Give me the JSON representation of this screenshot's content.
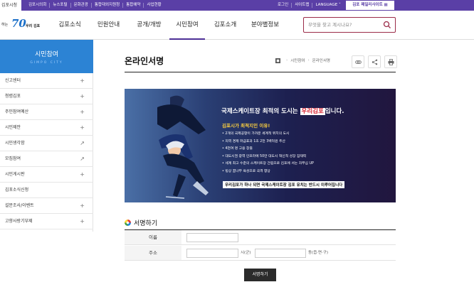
{
  "topbar": {
    "site_name": "김포시청",
    "links": [
      "김포시의회",
      "뉴스포털",
      "문화관광",
      "통합대외지원청",
      "통합예약",
      "사업현황"
    ],
    "login": "로그인",
    "sitemap": "사이트맵",
    "language": "LANGUAGE ˅",
    "family_site": "김포 패밀리사이트 ▦",
    "colors": {
      "bar": "#5a3fa6"
    }
  },
  "header": {
    "logo": {
      "prefix": "하는",
      "number": "70",
      "name": "우리 김포"
    },
    "nav": [
      "김포소식",
      "민원안내",
      "공개/개방",
      "시민참여",
      "김포소개",
      "분야별정보"
    ],
    "active_nav": "시민참여",
    "search_placeholder": "무엇을 찾고 계시나요?"
  },
  "sidebar": {
    "title": "시민참여",
    "subtitle": "GIMPO CITY",
    "items": [
      {
        "label": "신고센터",
        "marker": "+"
      },
      {
        "label": "청렴김포",
        "marker": "+"
      },
      {
        "label": "주민참여예산",
        "marker": "+"
      },
      {
        "label": "시민제안",
        "marker": "+"
      },
      {
        "label": "시민생각함",
        "marker": "↗"
      },
      {
        "label": "모집참여",
        "marker": "↗"
      },
      {
        "label": "시민게시판",
        "marker": "+"
      },
      {
        "label": "김포소식신청",
        "marker": ""
      },
      {
        "label": "설문조사/이벤트",
        "marker": "+"
      },
      {
        "label": "고향사랑기부제",
        "marker": "+"
      }
    ]
  },
  "content": {
    "title": "온라인서명",
    "breadcrumb": [
      "시민참여",
      "온라인서명"
    ],
    "tools": [
      "link-icon",
      "share-icon",
      "print-icon"
    ]
  },
  "banner": {
    "headline_before": "국제스케이트장 최적의 도시는 ",
    "headline_highlight": "우리김포",
    "headline_after": "입니다.",
    "subheading": "김포시가 최적지인 이유!",
    "reasons": [
      "• 2개의 국제공항이 가까운 세계적 위치의 도시",
      "• 지역 경제 파급효과 1조 2천 3백억원 추산",
      "• 4천여 명 고용 창출",
      "• 대도시권 광역 인프라에 50만 대도시 혁신적 성장 잠재력",
      "• 세계 최고 수준의 스케이트장 건립으로 김포에 서는 자부심 UP",
      "• 빙상 꿈나무 육성으로 국격 향상"
    ],
    "footer": "우리김포가 하나 되면 국제스케이트장 김포 유치는 반드시 이루어집니다"
  },
  "form": {
    "title": "서명하기",
    "name_label": "이름",
    "address_label": "주소",
    "city_unit": "시(군)",
    "dong_unit": "동(읍·면·구)",
    "submit": "서명하기"
  }
}
